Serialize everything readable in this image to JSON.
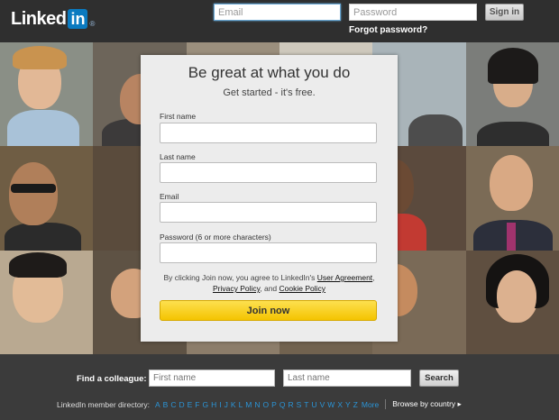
{
  "header": {
    "logo_text": "Linked",
    "logo_in": "in",
    "logo_reg": "®",
    "email_placeholder": "Email",
    "password_placeholder": "Password",
    "signin_label": "Sign in",
    "forgot_label": "Forgot password?"
  },
  "signup": {
    "title": "Be great at what you do",
    "subtitle": "Get started - it's free.",
    "fields": [
      {
        "label": "First name",
        "value": ""
      },
      {
        "label": "Last name",
        "value": ""
      },
      {
        "label": "Email",
        "value": ""
      },
      {
        "label": "Password (6 or more characters)",
        "value": ""
      }
    ],
    "legal_prefix": "By clicking Join now, you agree to LinkedIn's ",
    "user_agreement": "User Agreement",
    "legal_comma": ",",
    "privacy_policy": "Privacy Policy",
    "legal_and": ", and ",
    "cookie_policy": "Cookie Policy",
    "join_label": "Join now"
  },
  "footer": {
    "find_label": "Find a colleague:",
    "first_placeholder": "First name",
    "last_placeholder": "Last name",
    "search_label": "Search",
    "directory_label": "LinkedIn member directory:",
    "letters": [
      "A",
      "B",
      "C",
      "D",
      "E",
      "F",
      "G",
      "H",
      "I",
      "J",
      "K",
      "L",
      "M",
      "N",
      "O",
      "P",
      "Q",
      "R",
      "S",
      "T",
      "U",
      "V",
      "W",
      "X",
      "Y",
      "Z"
    ],
    "more_label": "More",
    "browse_label": "Browse by country ▸"
  },
  "colors": {
    "brand_blue": "#0a7ac0",
    "join_yellow": "#f4c400",
    "link_blue": "#2b94d6"
  }
}
